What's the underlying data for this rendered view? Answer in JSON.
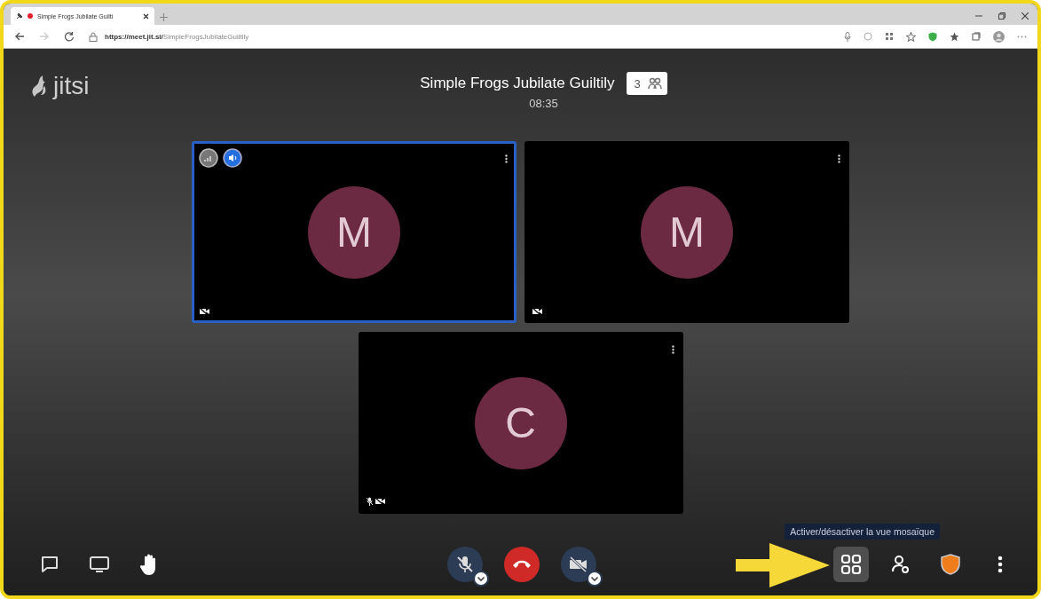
{
  "browser": {
    "tab": {
      "title": "Simple Frogs Jubilate Guilti",
      "recording": true
    },
    "url": {
      "host": "https://meet.jit.si/",
      "path": "SimpleFrogsJubilateGuiltily"
    }
  },
  "meeting": {
    "logo": "jitsi",
    "title": "Simple Frogs Jubilate Guiltily",
    "participant_count": "3",
    "elapsed": "08:35"
  },
  "tiles": [
    {
      "initial": "M",
      "selected": true,
      "speaking": true,
      "mic_muted": false,
      "video_muted": true
    },
    {
      "initial": "M",
      "selected": false,
      "speaking": false,
      "mic_muted": false,
      "video_muted": true
    },
    {
      "initial": "C",
      "selected": false,
      "speaking": false,
      "mic_muted": true,
      "video_muted": true
    }
  ],
  "toolbar": {
    "left": [
      {
        "kind": "chat"
      },
      {
        "kind": "screen"
      },
      {
        "kind": "hand"
      }
    ],
    "center": [
      {
        "kind": "mic",
        "muted": true
      },
      {
        "kind": "hangup"
      },
      {
        "kind": "camera",
        "muted": true
      }
    ],
    "right": [
      {
        "kind": "tileview",
        "selected": true,
        "tooltip": "Activer/désactiver la vue mosaïque"
      },
      {
        "kind": "participants",
        "selected": false
      },
      {
        "kind": "security",
        "selected": false
      },
      {
        "kind": "more",
        "selected": false
      }
    ]
  }
}
